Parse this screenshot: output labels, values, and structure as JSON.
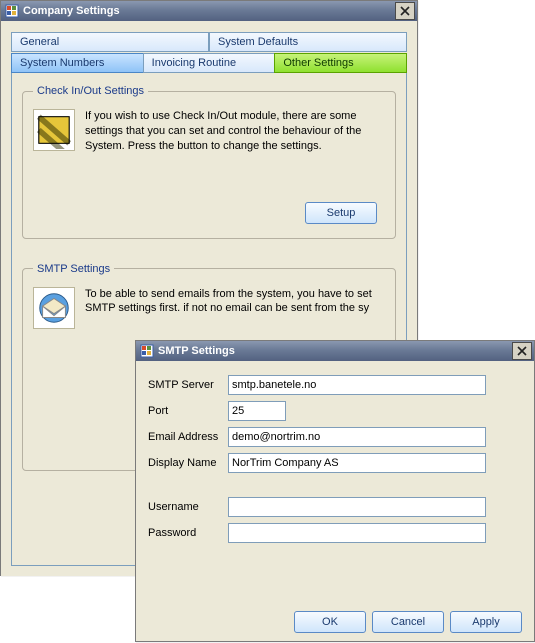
{
  "main_window": {
    "title": "Company Settings",
    "tabs_row1": [
      {
        "label": "General"
      },
      {
        "label": "System Defaults"
      }
    ],
    "tabs_row2": [
      {
        "label": "System Numbers"
      },
      {
        "label": "Invoicing Routine"
      },
      {
        "label": "Other Settings"
      }
    ],
    "checkinout": {
      "legend": "Check In/Out Settings",
      "text": "If you wish to use Check In/Out module, there are some settings that you can set and control the behaviour of the System. Press the button to change the settings.",
      "button": "Setup"
    },
    "smtp_section": {
      "legend": "SMTP Settings",
      "text": "To be able to send emails from the system, you have to set SMTP settings first. if not no email can be sent from the sy"
    }
  },
  "smtp_dialog": {
    "title": "SMTP Settings",
    "fields": {
      "server_label": "SMTP Server",
      "server_value": "smtp.banetele.no",
      "port_label": "Port",
      "port_value": "25",
      "email_label": "Email Address",
      "email_value": "demo@nortrim.no",
      "display_label": "Display Name",
      "display_value": "NorTrim Company AS",
      "username_label": "Username",
      "username_value": "",
      "password_label": "Password",
      "password_value": ""
    },
    "buttons": {
      "ok": "OK",
      "cancel": "Cancel",
      "apply": "Apply"
    }
  }
}
